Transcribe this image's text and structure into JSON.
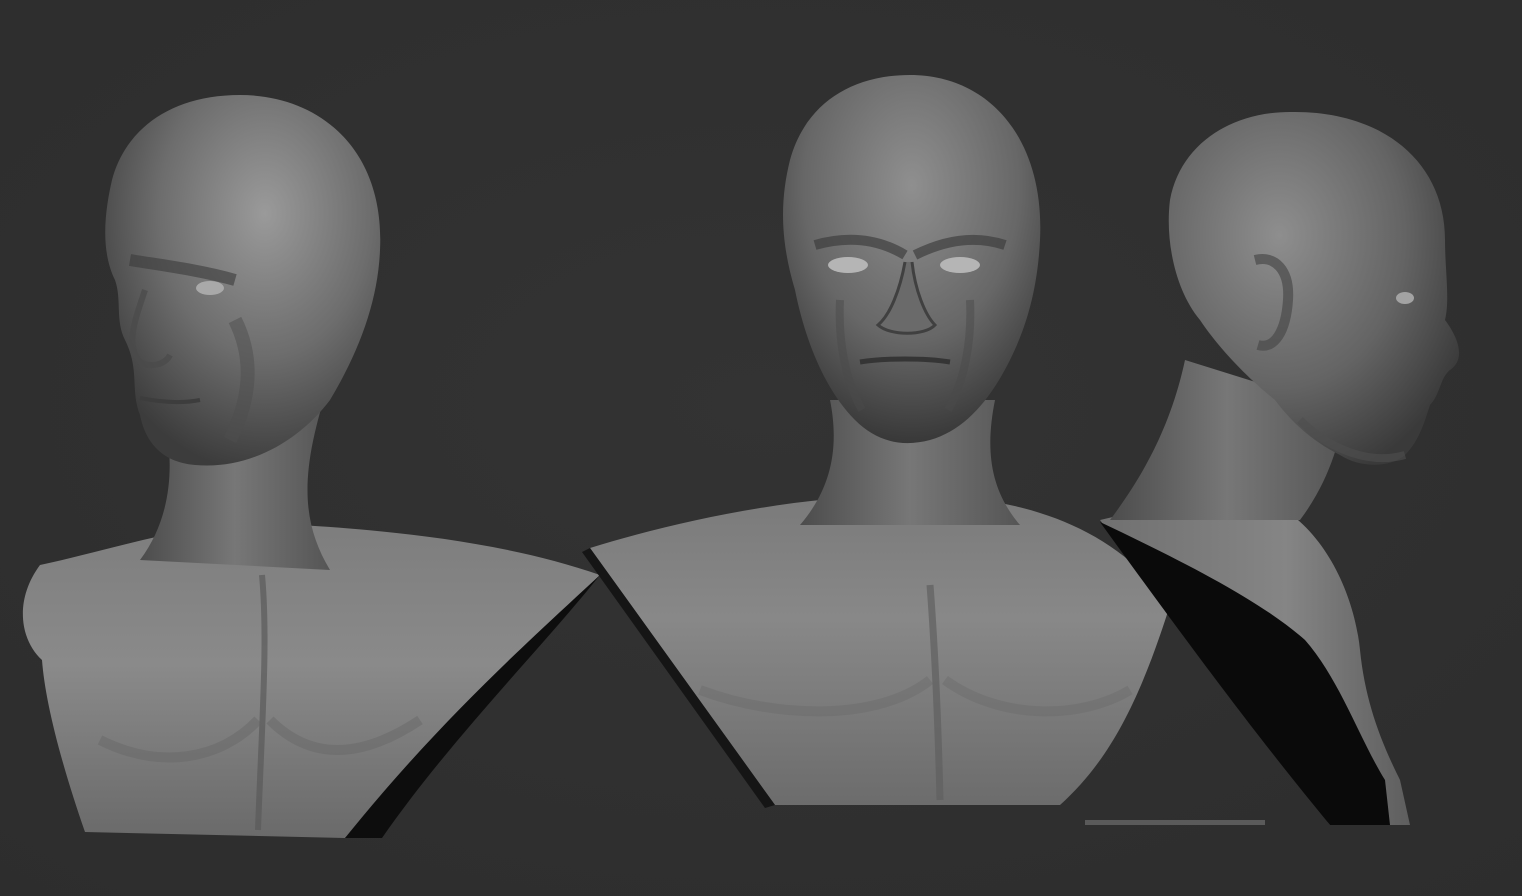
{
  "scene": {
    "background_color": "#2d2d2d",
    "material_color": "#8a8a8a",
    "shadow_color": "#0a0a0a",
    "views": [
      {
        "view": "three-quarter-left"
      },
      {
        "view": "front"
      },
      {
        "view": "profile-right"
      }
    ]
  }
}
